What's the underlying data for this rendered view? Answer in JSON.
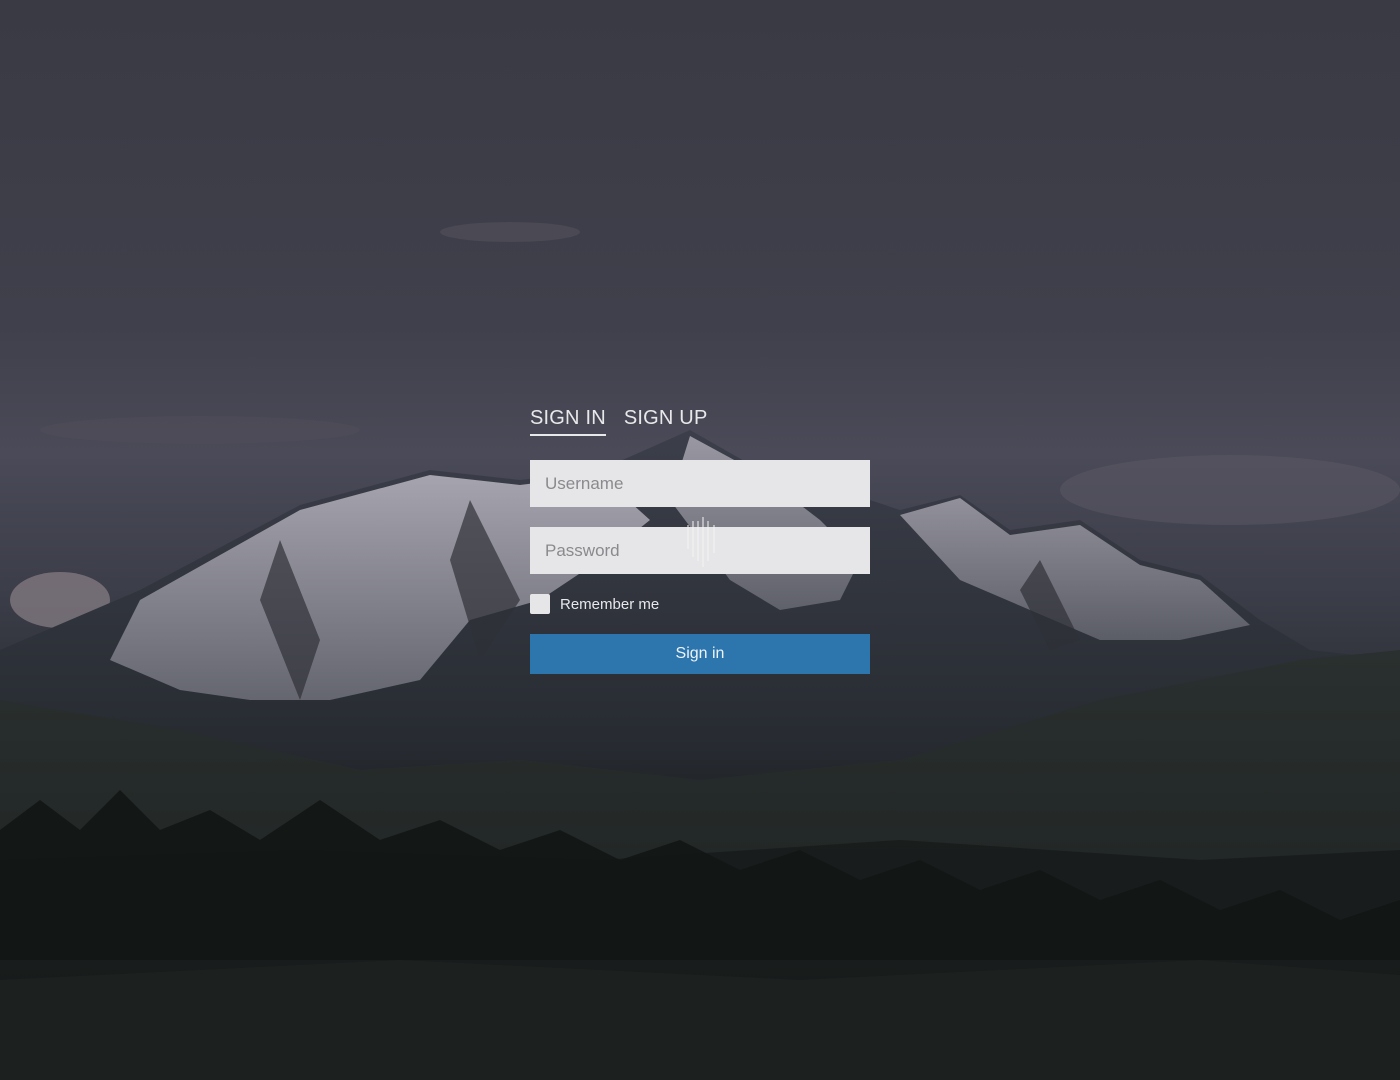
{
  "tabs": {
    "sign_in": "SIGN IN",
    "sign_up": "SIGN UP",
    "active": "sign_in"
  },
  "form": {
    "username_placeholder": "Username",
    "password_placeholder": "Password",
    "remember_label": "Remember me",
    "remember_checked": false,
    "submit_label": "Sign in"
  },
  "colors": {
    "accent": "#2d75ad",
    "field_bg": "#e6e6e8",
    "text_light": "#e8e8ea"
  },
  "background": {
    "subject": "mountain-landscape-photo"
  }
}
